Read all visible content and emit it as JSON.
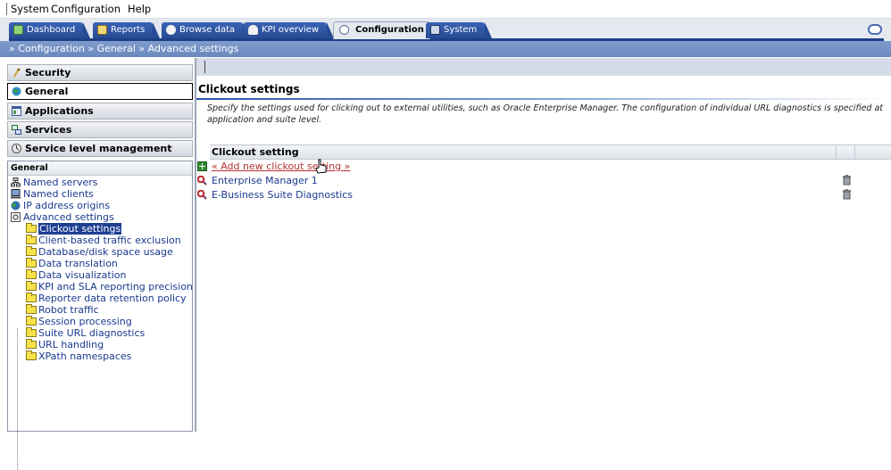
{
  "menubar": {
    "items": [
      "System",
      "Configuration",
      "Help"
    ]
  },
  "tabs": [
    {
      "label": "Dashboard",
      "icon": "dashboard-icon",
      "color": "#8fd27a"
    },
    {
      "label": "Reports",
      "icon": "reports-icon",
      "color": "#f0d87a"
    },
    {
      "label": "Browse data",
      "icon": "browse-data-icon",
      "color": "#f4f4f4"
    },
    {
      "label": "KPI overview",
      "icon": "kpi-icon",
      "color": "#f0f0f0"
    },
    {
      "label": "Configuration",
      "icon": "configuration-icon",
      "active": true
    },
    {
      "label": "System",
      "icon": "system-icon",
      "color": "#cfd8e6"
    }
  ],
  "breadcrumb": "» Configuration » General » Advanced settings",
  "sidebar": {
    "sections": [
      {
        "label": "Security",
        "icon": "security-icon"
      },
      {
        "label": "General",
        "icon": "globe-icon",
        "selected": true
      },
      {
        "label": "Applications",
        "icon": "applications-icon"
      },
      {
        "label": "Services",
        "icon": "services-icon"
      },
      {
        "label": "Service level management",
        "icon": "service-level-icon"
      }
    ],
    "tree_header": "General",
    "tree_items": [
      {
        "label": "Named servers",
        "icon": "servers-icon",
        "level": 0
      },
      {
        "label": "Named clients",
        "icon": "clients-icon",
        "level": 0
      },
      {
        "label": "IP address origins",
        "icon": "globe-icon",
        "level": 0
      },
      {
        "label": "Advanced settings",
        "icon": "settings-icon",
        "level": 0
      },
      {
        "label": "Clickout settings",
        "icon": "folder-open-icon",
        "level": 1,
        "selected": true
      },
      {
        "label": "Client-based traffic exclusion",
        "icon": "folder-icon",
        "level": 1
      },
      {
        "label": "Database/disk space usage",
        "icon": "folder-icon",
        "level": 1
      },
      {
        "label": "Data translation",
        "icon": "folder-icon",
        "level": 1
      },
      {
        "label": "Data visualization",
        "icon": "folder-icon",
        "level": 1
      },
      {
        "label": "KPI and SLA reporting precision",
        "icon": "folder-icon",
        "level": 1
      },
      {
        "label": "Reporter data retention policy",
        "icon": "folder-icon",
        "level": 1
      },
      {
        "label": "Robot traffic",
        "icon": "folder-icon",
        "level": 1
      },
      {
        "label": "Session processing",
        "icon": "folder-icon",
        "level": 1
      },
      {
        "label": "Suite URL diagnostics",
        "icon": "folder-icon",
        "level": 1
      },
      {
        "label": "URL handling",
        "icon": "folder-icon",
        "level": 1
      },
      {
        "label": "XPath namespaces",
        "icon": "folder-icon",
        "level": 1
      }
    ]
  },
  "main": {
    "title": "Clickout settings",
    "description": "Specify the settings used for clicking out to external utilities, such as Oracle Enterprise Manager. The configuration of individual URL diagnostics is specified at application and suite level.",
    "table": {
      "header": "Clickout setting",
      "add_link": "« Add new clickout setting »",
      "rows": [
        "Enterprise Manager 1",
        "E-Business Suite Diagnostics"
      ]
    }
  }
}
